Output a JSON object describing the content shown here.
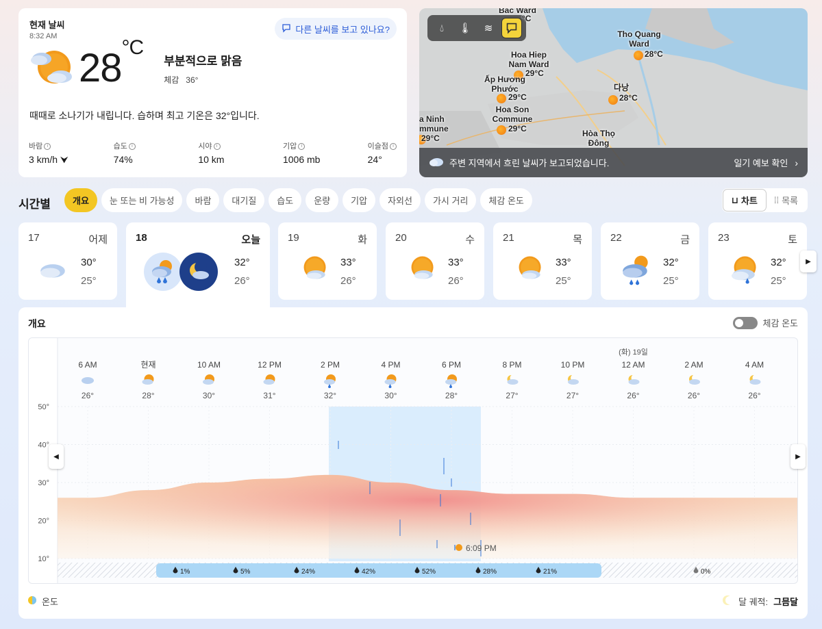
{
  "current": {
    "title": "현재 날씨",
    "time": "8:32 AM",
    "other_weather_label": "다른 날씨를 보고 있나요?",
    "temp": "28",
    "unit": "°C",
    "condition": "부분적으로 맑음",
    "feels_label": "체감",
    "feels_value": "36°",
    "description": "때때로 소나기가 내립니다. 습하며 최고 기온은 32°입니다.",
    "stats": [
      {
        "label": "바람",
        "value": "3 km/h"
      },
      {
        "label": "습도",
        "value": "74%"
      },
      {
        "label": "시야",
        "value": "10 km"
      },
      {
        "label": "기압",
        "value": "1006 mb"
      },
      {
        "label": "이슬점",
        "value": "24°"
      }
    ]
  },
  "map": {
    "labels": [
      {
        "text": "Bac Ward"
      },
      {
        "text": "°C"
      },
      {
        "text": "Tho Quang Ward"
      },
      {
        "text": "28°C"
      },
      {
        "text": "Hoa Hiep Nam Ward"
      },
      {
        "text": "29°C"
      },
      {
        "text": "Ấp Hương Phước"
      },
      {
        "text": "29°C"
      },
      {
        "text": "다낭"
      },
      {
        "text": "28°C"
      },
      {
        "text": "Hoa Son Commune"
      },
      {
        "text": "29°C"
      },
      {
        "text": "a Ninh mmune"
      },
      {
        "text": "29°C"
      },
      {
        "text": "Hòa Thọ Đông"
      }
    ],
    "banner_text": "주변 지역에서 흐린 날씨가 보고되었습니다.",
    "banner_link": "일기 예보 확인"
  },
  "hourly": {
    "title": "시간별",
    "chips": [
      "개요",
      "눈 또는 비 가능성",
      "바람",
      "대기질",
      "습도",
      "운량",
      "기압",
      "자외선",
      "가시 거리",
      "체감 온도"
    ],
    "view_chart": "차트",
    "view_list": "목록"
  },
  "days": [
    {
      "num": "17",
      "name": "어제",
      "hi": "30°",
      "lo": "25°",
      "icon": "cloudy-icon"
    },
    {
      "num": "18",
      "name": "오늘",
      "hi": "32°",
      "lo": "26°",
      "icon": "rain-and-night-icon"
    },
    {
      "num": "19",
      "name": "화",
      "hi": "33°",
      "lo": "26°",
      "icon": "partly-sunny-icon"
    },
    {
      "num": "20",
      "name": "수",
      "hi": "33°",
      "lo": "26°",
      "icon": "partly-sunny-icon"
    },
    {
      "num": "21",
      "name": "목",
      "hi": "33°",
      "lo": "25°",
      "icon": "partly-sunny-icon"
    },
    {
      "num": "22",
      "name": "금",
      "hi": "32°",
      "lo": "25°",
      "icon": "thunder-rain-icon"
    },
    {
      "num": "23",
      "name": "토",
      "hi": "32°",
      "lo": "25°",
      "icon": "sun-shower-icon"
    }
  ],
  "overview": {
    "title": "개요",
    "feels_toggle_label": "체감 온도",
    "legend_label": "온도",
    "moon_label": "달 궤적:",
    "moon_value": "그믐달",
    "sunset_label": "6:09 PM"
  },
  "chart_data": {
    "type": "area",
    "hours": [
      "6 AM",
      "현재",
      "10 AM",
      "12 PM",
      "2 PM",
      "4 PM",
      "6 PM",
      "8 PM",
      "10 PM",
      "12 AM",
      "2 AM",
      "4 AM"
    ],
    "day_marker": "(화) 19일",
    "temps": [
      26,
      28,
      30,
      31,
      32,
      30,
      28,
      27,
      27,
      26,
      26,
      26
    ],
    "temp_labels": [
      "26°",
      "28°",
      "30°",
      "31°",
      "32°",
      "30°",
      "28°",
      "27°",
      "27°",
      "26°",
      "26°",
      "26°"
    ],
    "hour_icons": [
      "cloudy-icon",
      "partly-sunny-icon",
      "partly-sunny-icon",
      "partly-sunny-icon",
      "sun-shower-icon",
      "sun-shower-icon",
      "sun-shower-icon",
      "night-cloudy-icon",
      "night-cloudy-icon",
      "night-cloudy-icon",
      "night-cloudy-icon",
      "night-cloudy-icon"
    ],
    "y_ticks": [
      "50°",
      "40°",
      "30°",
      "20°",
      "10°"
    ],
    "ylim": [
      10,
      50
    ],
    "precip": [
      "1%",
      "5%",
      "24%",
      "42%",
      "52%",
      "28%",
      "21%",
      "0%"
    ],
    "colors": {
      "temp_warm": "#f7c9a3",
      "temp_hot": "#f08b80",
      "rain_band": "#bfe0fb",
      "precip_bar": "#abd7f6"
    }
  }
}
